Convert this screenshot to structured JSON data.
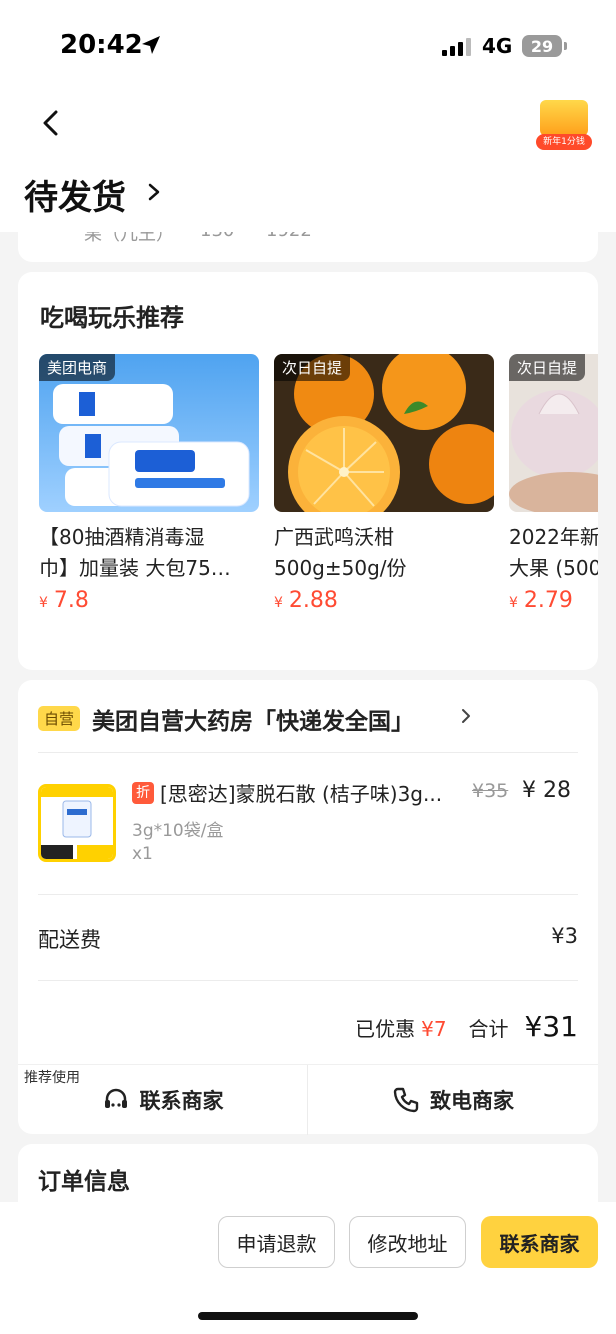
{
  "status": {
    "time": "20:42",
    "network": "4G",
    "battery": "29"
  },
  "header": {
    "title": "待发货",
    "promo_label": "新年1分钱"
  },
  "prev_card": {
    "frag1": "果（几王）",
    "frag2": "130",
    "frag3": "1922"
  },
  "recommend": {
    "title": "吃喝玩乐推荐",
    "items": [
      {
        "tag": "美团电商",
        "name_line1": "【80抽酒精消毒湿",
        "name_line2": "巾】加量装 大包75…",
        "currency": "¥",
        "price": "7.8"
      },
      {
        "tag": "次日自提",
        "name_line1": "广西武鸣沃柑",
        "name_line2": "500g±50g/份",
        "currency": "¥",
        "price": "2.88"
      },
      {
        "tag": "次日自提",
        "name_line1": "2022年新",
        "name_line2": "大果 (500",
        "currency": "¥",
        "price": "2.79"
      }
    ]
  },
  "order": {
    "self_badge": "自营",
    "store_name": "美团自营大药房「快递发全国」",
    "discount_badge": "折",
    "product_name": "[思密达]蒙脱石散 (桔子味)3g...",
    "orig_price": "¥35",
    "cur_price": "¥ 28",
    "spec": "3g*10袋/盒",
    "qty": "x1",
    "fee_label": "配送费",
    "fee_value": "¥3",
    "discount_label": "已优惠",
    "discount_value": "¥7",
    "total_label": "合计",
    "total_value": "¥31",
    "recommend_use": "推荐使用",
    "contact_label": "联系商家",
    "call_label": "致电商家"
  },
  "info": {
    "title": "订单信息"
  },
  "bottom": {
    "refund": "申请退款",
    "address": "修改地址",
    "contact": "联系商家"
  }
}
